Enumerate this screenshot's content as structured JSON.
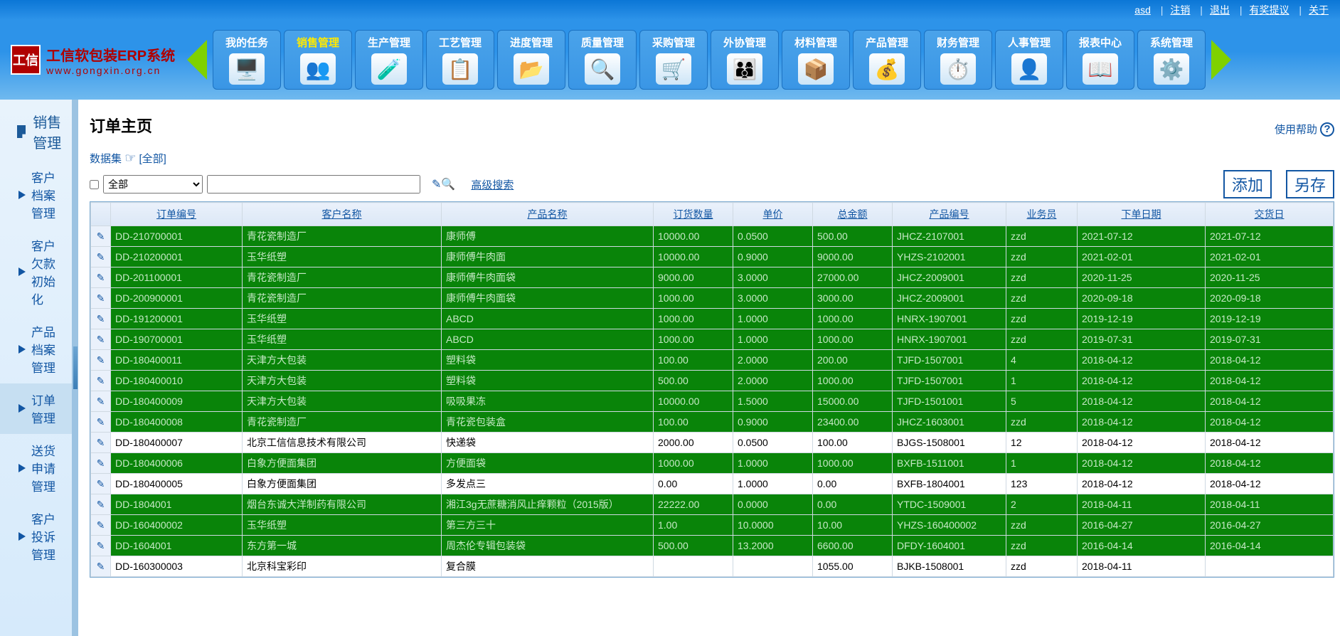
{
  "topbar": {
    "user": "asd",
    "logout": "注销",
    "exit": "退出",
    "suggest": "有奖提议",
    "about": "关于"
  },
  "brand": {
    "title": "工信软包装ERP系统",
    "sub": "www.gongxin.org.cn",
    "logo": "工信"
  },
  "nav": [
    {
      "label": "我的任务",
      "icon": "🖥️"
    },
    {
      "label": "销售管理",
      "icon": "👥",
      "active": true
    },
    {
      "label": "生产管理",
      "icon": "🧪"
    },
    {
      "label": "工艺管理",
      "icon": "📋"
    },
    {
      "label": "进度管理",
      "icon": "📂"
    },
    {
      "label": "质量管理",
      "icon": "🔍"
    },
    {
      "label": "采购管理",
      "icon": "🛒"
    },
    {
      "label": "外协管理",
      "icon": "👨‍👩‍👦"
    },
    {
      "label": "材料管理",
      "icon": "📦"
    },
    {
      "label": "产品管理",
      "icon": "💰"
    },
    {
      "label": "财务管理",
      "icon": "⏱️"
    },
    {
      "label": "人事管理",
      "icon": "👤"
    },
    {
      "label": "报表中心",
      "icon": "📖"
    },
    {
      "label": "系统管理",
      "icon": "⚙️"
    }
  ],
  "sidebar": {
    "title": "销售管理",
    "items": [
      {
        "label": "客户档案管理"
      },
      {
        "label": "客户欠款初始化"
      },
      {
        "label": "产品档案管理"
      },
      {
        "label": "订单管理",
        "active": true
      },
      {
        "label": "送货申请管理"
      },
      {
        "label": "客户投诉管理"
      }
    ]
  },
  "page": {
    "title": "订单主页",
    "help": "使用帮助",
    "dataset_prefix": "数据集",
    "dataset_suffix": "[全部]",
    "select_all": "全部",
    "adv_search": "高级搜索",
    "add": "添加",
    "save": "另存"
  },
  "columns": [
    "订单编号",
    "客户名称",
    "产品名称",
    "订货数量",
    "单价",
    "总金额",
    "产品编号",
    "业务员",
    "下单日期",
    "交货日"
  ],
  "rows": [
    {
      "g": true,
      "c": [
        "DD-210700001",
        "青花瓷制造厂",
        "康师傅",
        "10000.00",
        "0.0500",
        "500.00",
        "JHCZ-2107001",
        "zzd",
        "2021-07-12",
        "2021-07-12"
      ]
    },
    {
      "g": true,
      "c": [
        "DD-210200001",
        "玉华纸塑",
        "康师傅牛肉面",
        "10000.00",
        "0.9000",
        "9000.00",
        "YHZS-2102001",
        "zzd",
        "2021-02-01",
        "2021-02-01"
      ]
    },
    {
      "g": true,
      "c": [
        "DD-201100001",
        "青花瓷制造厂",
        "康师傅牛肉面袋",
        "9000.00",
        "3.0000",
        "27000.00",
        "JHCZ-2009001",
        "zzd",
        "2020-11-25",
        "2020-11-25"
      ]
    },
    {
      "g": true,
      "c": [
        "DD-200900001",
        "青花瓷制造厂",
        "康师傅牛肉面袋",
        "1000.00",
        "3.0000",
        "3000.00",
        "JHCZ-2009001",
        "zzd",
        "2020-09-18",
        "2020-09-18"
      ]
    },
    {
      "g": true,
      "c": [
        "DD-191200001",
        "玉华纸塑",
        "ABCD",
        "1000.00",
        "1.0000",
        "1000.00",
        "HNRX-1907001",
        "zzd",
        "2019-12-19",
        "2019-12-19"
      ]
    },
    {
      "g": true,
      "c": [
        "DD-190700001",
        "玉华纸塑",
        "ABCD",
        "1000.00",
        "1.0000",
        "1000.00",
        "HNRX-1907001",
        "zzd",
        "2019-07-31",
        "2019-07-31"
      ]
    },
    {
      "g": true,
      "c": [
        "DD-180400011",
        "天津方大包装",
        "塑料袋",
        "100.00",
        "2.0000",
        "200.00",
        "TJFD-1507001",
        "4",
        "2018-04-12",
        "2018-04-12"
      ]
    },
    {
      "g": true,
      "c": [
        "DD-180400010",
        "天津方大包装",
        "塑料袋",
        "500.00",
        "2.0000",
        "1000.00",
        "TJFD-1507001",
        "1",
        "2018-04-12",
        "2018-04-12"
      ]
    },
    {
      "g": true,
      "c": [
        "DD-180400009",
        "天津方大包装",
        "吸吸果冻",
        "10000.00",
        "1.5000",
        "15000.00",
        "TJFD-1501001",
        "5",
        "2018-04-12",
        "2018-04-12"
      ]
    },
    {
      "g": true,
      "c": [
        "DD-180400008",
        "青花瓷制造厂",
        "青花瓷包装盒",
        "100.00",
        "0.9000",
        "23400.00",
        "JHCZ-1603001",
        "zzd",
        "2018-04-12",
        "2018-04-12"
      ]
    },
    {
      "g": false,
      "c": [
        "DD-180400007",
        "北京工信信息技术有限公司",
        "快递袋",
        "2000.00",
        "0.0500",
        "100.00",
        "BJGS-1508001",
        "12",
        "2018-04-12",
        "2018-04-12"
      ]
    },
    {
      "g": true,
      "c": [
        "DD-180400006",
        "白象方便面集团",
        "方便面袋",
        "1000.00",
        "1.0000",
        "1000.00",
        "BXFB-1511001",
        "1",
        "2018-04-12",
        "2018-04-12"
      ]
    },
    {
      "g": false,
      "c": [
        "DD-180400005",
        "白象方便面集团",
        "多发点三",
        "0.00",
        "1.0000",
        "0.00",
        "BXFB-1804001",
        "123",
        "2018-04-12",
        "2018-04-12"
      ]
    },
    {
      "g": true,
      "c": [
        "DD-1804001",
        "烟台东诚大洋制药有限公司",
        "湘江3g无蔗糖消风止痒颗粒（2015版）",
        "22222.00",
        "0.0000",
        "0.00",
        "YTDC-1509001",
        "2",
        "2018-04-11",
        "2018-04-11"
      ]
    },
    {
      "g": true,
      "c": [
        "DD-160400002",
        "玉华纸塑",
        "第三方三十",
        "1.00",
        "10.0000",
        "10.00",
        "YHZS-160400002",
        "zzd",
        "2016-04-27",
        "2016-04-27"
      ]
    },
    {
      "g": true,
      "c": [
        "DD-1604001",
        "东方第一城",
        "周杰伦专辑包装袋",
        "500.00",
        "13.2000",
        "6600.00",
        "DFDY-1604001",
        "zzd",
        "2016-04-14",
        "2016-04-14"
      ]
    },
    {
      "g": false,
      "c": [
        "DD-160300003",
        "北京科宝彩印",
        "复合膜",
        "",
        "",
        "1055.00",
        "BJKB-1508001",
        "zzd",
        "2018-04-11",
        ""
      ]
    }
  ]
}
